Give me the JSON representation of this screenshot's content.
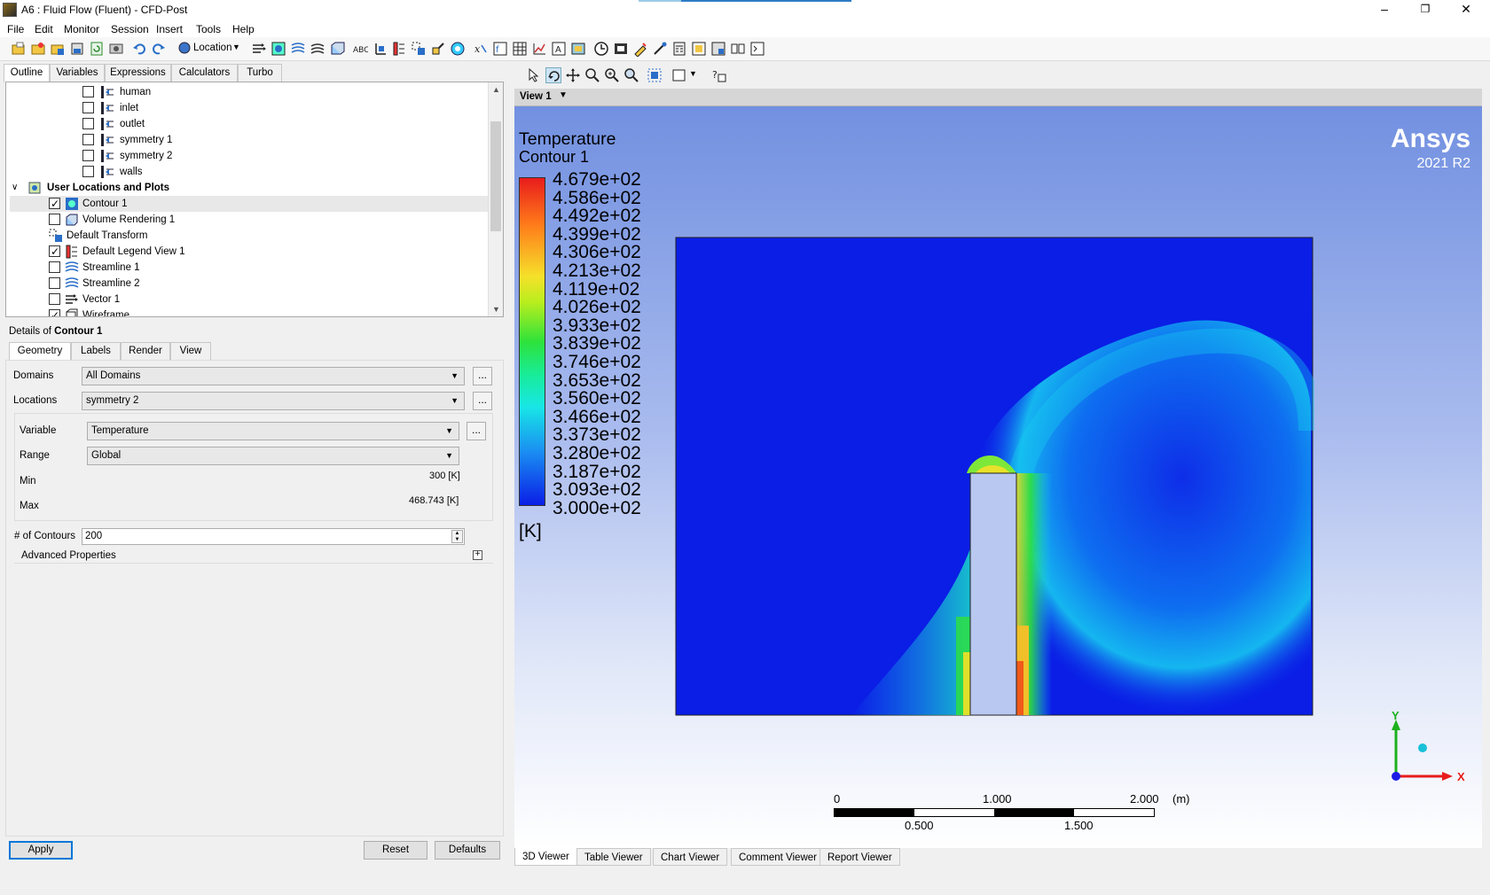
{
  "window": {
    "title": "A6 : Fluid Flow (Fluent) - CFD-Post",
    "controls": [
      "–",
      "❐",
      "✕"
    ]
  },
  "menu": [
    "File",
    "Edit",
    "Monitor",
    "Session",
    "Insert",
    "Tools",
    "Help"
  ],
  "toolbar": {
    "location_label": "Location"
  },
  "left_tabs": [
    "Outline",
    "Variables",
    "Expressions",
    "Calculators",
    "Turbo"
  ],
  "tree": {
    "items": [
      {
        "label": "human",
        "checked": false
      },
      {
        "label": "inlet",
        "checked": false
      },
      {
        "label": "outlet",
        "checked": false
      },
      {
        "label": "symmetry 1",
        "checked": false
      },
      {
        "label": "symmetry 2",
        "checked": false
      },
      {
        "label": "walls",
        "checked": false
      }
    ],
    "group_label": "User Locations and Plots",
    "group_items": [
      {
        "label": "Contour 1",
        "checked": true
      },
      {
        "label": "Volume Rendering 1",
        "checked": false
      },
      {
        "label": "Default Transform",
        "checked": null
      },
      {
        "label": "Default Legend View 1",
        "checked": true
      },
      {
        "label": "Streamline 1",
        "checked": false
      },
      {
        "label": "Streamline 2",
        "checked": false
      },
      {
        "label": "Vector 1",
        "checked": false
      },
      {
        "label": "Wireframe",
        "checked": true
      }
    ]
  },
  "details": {
    "title_prefix": "Details of",
    "title_object": "Contour 1",
    "tabs": [
      "Geometry",
      "Labels",
      "Render",
      "View"
    ],
    "domains_label": "Domains",
    "domains_value": "All Domains",
    "locations_label": "Locations",
    "locations_value": "symmetry 2",
    "variable_label": "Variable",
    "variable_value": "Temperature",
    "range_label": "Range",
    "range_value": "Global",
    "min_label": "Min",
    "min_value": "300 [K]",
    "max_label": "Max",
    "max_value": "468.743 [K]",
    "contours_label": "# of Contours",
    "contours_value": "200",
    "advanced_label": "Advanced Properties",
    "dots": "..."
  },
  "buttons": {
    "apply": "Apply",
    "reset": "Reset",
    "defaults": "Defaults"
  },
  "viewer": {
    "view_name": "View 1",
    "legend_title": "Temperature",
    "legend_subtitle": "Contour 1",
    "legend_values": [
      "4.679e+02",
      "4.586e+02",
      "4.492e+02",
      "4.399e+02",
      "4.306e+02",
      "4.213e+02",
      "4.119e+02",
      "4.026e+02",
      "3.933e+02",
      "3.839e+02",
      "3.746e+02",
      "3.653e+02",
      "3.560e+02",
      "3.466e+02",
      "3.373e+02",
      "3.280e+02",
      "3.187e+02",
      "3.093e+02",
      "3.000e+02"
    ],
    "legend_unit": "[K]",
    "brand": "Ansys",
    "version": "2021 R2",
    "scale_top": [
      "0",
      "1.000",
      "2.000"
    ],
    "scale_unit": "(m)",
    "scale_bottom": [
      "0.500",
      "1.500"
    ],
    "axis_y": "Y",
    "axis_x": "X",
    "colors": {
      "cold": "#0a1ee6",
      "hot": "#e81c1c",
      "mid": "#2ee23a"
    }
  },
  "viewer_tabs": [
    "3D Viewer",
    "Table Viewer",
    "Chart Viewer",
    "Comment Viewer",
    "Report Viewer"
  ]
}
